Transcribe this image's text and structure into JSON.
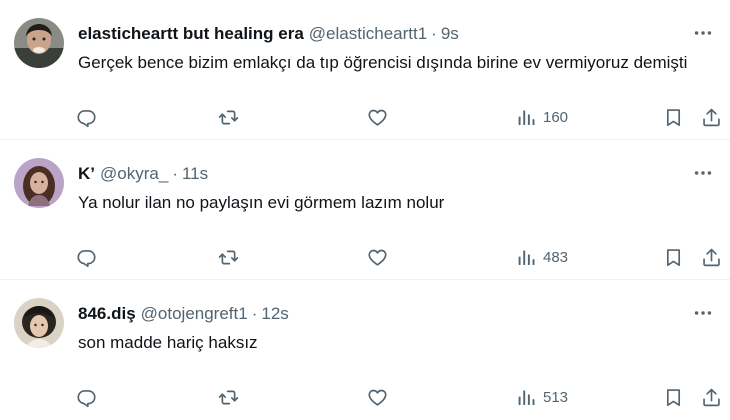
{
  "colors": {
    "text": "#0f1419",
    "muted": "#536471",
    "divider": "#eff3f4"
  },
  "icons": [
    "reply-icon",
    "retweet-icon",
    "like-icon",
    "views-icon",
    "bookmark-icon",
    "share-icon",
    "more-icon"
  ],
  "tweets": [
    {
      "name": "elasticheartt but healing era",
      "handle": "@elasticheartt1",
      "separator": "·",
      "time": "9s",
      "text": "Gerçek bence bizim emlakçı da tıp öğrencisi dışında birine ev vermiyoruz demişti",
      "views": "160"
    },
    {
      "name": "K’",
      "handle": "@okyra_",
      "separator": "·",
      "time": "11s",
      "text": "Ya nolur ilan no paylaşın evi görmem lazım nolur",
      "views": "483"
    },
    {
      "name": "846.diş",
      "handle": "@otojengreft1",
      "separator": "·",
      "time": "12s",
      "text": "son madde hariç haksız",
      "views": "513"
    }
  ]
}
